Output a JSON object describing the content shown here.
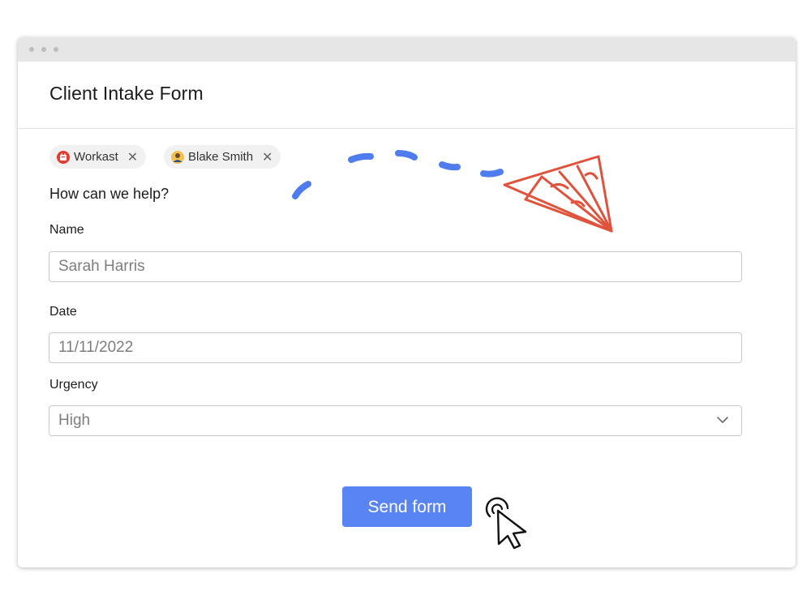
{
  "form": {
    "title": "Client Intake Form",
    "subtitle": "How can we help?"
  },
  "chips": [
    {
      "label": "Workast",
      "icon": "workast-logo-icon",
      "close": "✕"
    },
    {
      "label": "Blake Smith",
      "icon": "avatar-icon",
      "close": "✕"
    }
  ],
  "fields": {
    "name": {
      "label": "Name",
      "value": "Sarah Harris"
    },
    "date": {
      "label": "Date",
      "value": "11/11/2022"
    },
    "urgency": {
      "label": "Urgency",
      "value": "High",
      "icon": "chevron-down-icon"
    }
  },
  "actions": {
    "send_label": "Send form"
  },
  "colors": {
    "accent": "#5884f4",
    "plane": "#e0523c",
    "dash": "#4f7df0",
    "chip_bg": "#f1f1f1"
  }
}
